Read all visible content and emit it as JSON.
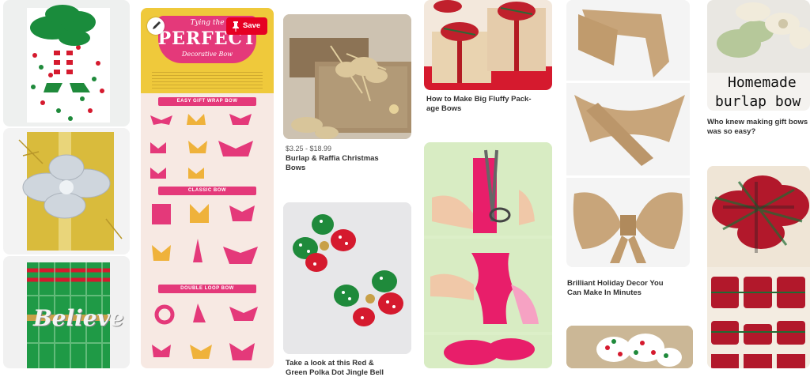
{
  "pin_actions": {
    "save_label": "Save"
  },
  "infographic": {
    "heading_small": "Tying the",
    "heading_big": "PERFECT",
    "heading_sub": "Decorative Bow",
    "section_1": "Easy Gift Wrap Bow",
    "section_2": "Classic Bow",
    "section_3": "Double Loop Bow"
  },
  "pins": [
    {
      "id": "burlap-raffia",
      "price": "$3.25 - $18.99",
      "title_line1": "Burlap & Raffia Christmas",
      "title_line2": "Bows"
    },
    {
      "id": "red-green-bows",
      "title_line1": "Take a look at this Red &",
      "title_line2": "Green Polka Dot Jingle Bell"
    },
    {
      "id": "big-fluffy",
      "title_line1": "How to Make Big Fluffy Pack-",
      "title_line2": "age Bows"
    },
    {
      "id": "brilliant-holiday",
      "title_line1": "Brilliant Holiday Decor You",
      "title_line2": "Can Make In Minutes"
    },
    {
      "id": "homemade-burlap",
      "overlay_line1": "Homemade",
      "overlay_line2": "burlap bow",
      "title_line1": "Who knew making gift bows",
      "title_line2": "was so easy?"
    }
  ],
  "gift_text": {
    "believe": "Believe"
  },
  "colors": {
    "save_red": "#e60023",
    "ribbon_red": "#d51a2e",
    "ribbon_green": "#1f8a3b",
    "infographic_pink": "#e4397a",
    "burlap": "#c8a57a"
  }
}
